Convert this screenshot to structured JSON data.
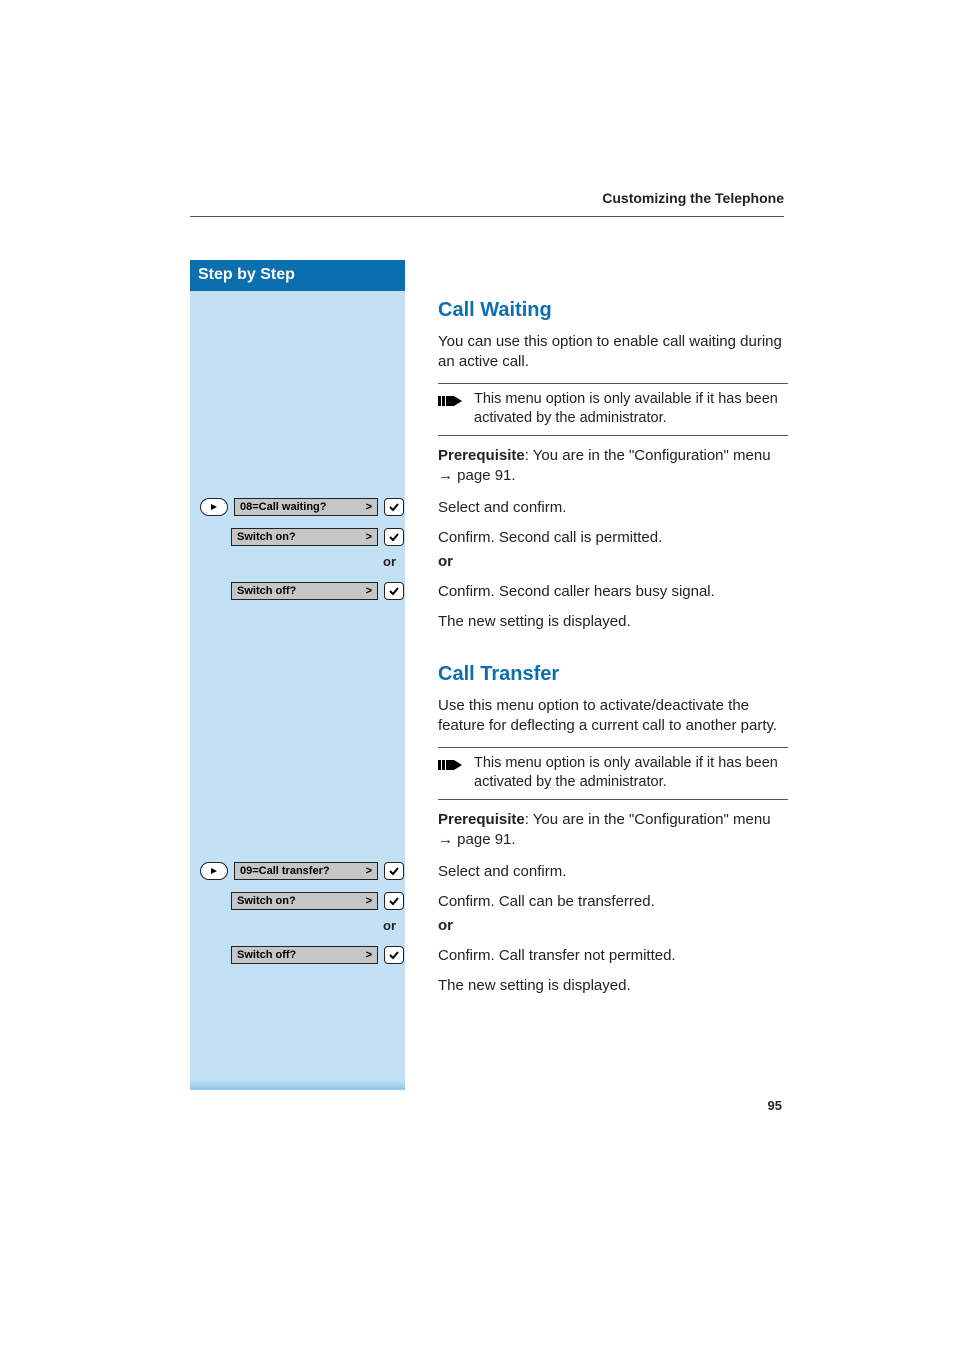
{
  "header": {
    "running_head": "Customizing the Telephone"
  },
  "sidebar": {
    "title": "Step by Step"
  },
  "sections": [
    {
      "title": "Call Waiting",
      "intro": "You can use this option to enable call waiting during an active call.",
      "note": "This menu option is only available if it has been activated by the administrator.",
      "prereq_label": "Prerequisite",
      "prereq_text": ": You are in the \"Configuration\" menu",
      "prereq_ref": "page 91.",
      "steps": [
        {
          "display": "08=Call waiting?",
          "scroll": true,
          "text": "Select and confirm."
        },
        {
          "display": "Switch on?",
          "scroll": false,
          "text": "Confirm. Second call is permitted."
        },
        {
          "or": "or"
        },
        {
          "display": "Switch off?",
          "scroll": false,
          "text": "Confirm. Second caller hears busy signal."
        }
      ],
      "result": "The new setting is displayed."
    },
    {
      "title": "Call Transfer",
      "intro": "Use this menu option to activate/deactivate the feature for deflecting a current call to another party.",
      "note": "This menu option is only available if it has been activated by the administrator.",
      "prereq_label": "Prerequisite",
      "prereq_text": ": You are in the \"Configuration\" menu",
      "prereq_ref": "page 91.",
      "steps": [
        {
          "display": "09=Call transfer?",
          "scroll": true,
          "text": "Select and confirm."
        },
        {
          "display": "Switch on?",
          "scroll": false,
          "text": "Confirm. Call can be transferred."
        },
        {
          "or": "or"
        },
        {
          "display": "Switch off?",
          "scroll": false,
          "text": "Confirm. Call transfer not permitted."
        }
      ],
      "result": "The new setting is displayed."
    }
  ],
  "page_number": "95",
  "glyphs": {
    "chevron": ">",
    "arrow": "→"
  }
}
